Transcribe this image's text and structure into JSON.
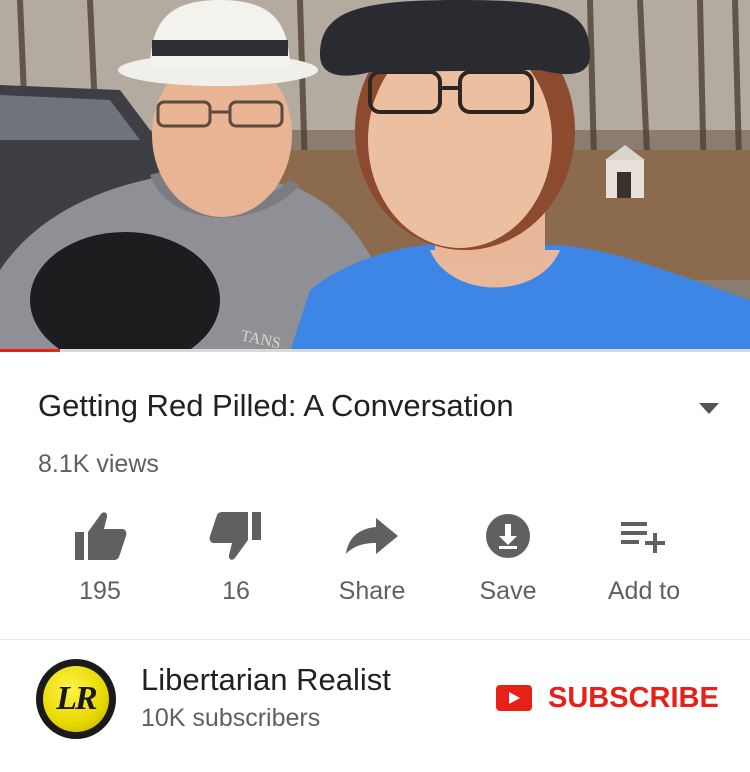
{
  "video": {
    "title": "Getting Red Pilled: A Conversation",
    "views": "8.1K views",
    "progress": 0.08
  },
  "actions": [
    {
      "icon": "thumbs-up-icon",
      "label": "195"
    },
    {
      "icon": "thumbs-down-icon",
      "label": "16"
    },
    {
      "icon": "share-arrow-icon",
      "label": "Share"
    },
    {
      "icon": "download-icon",
      "label": "Save"
    },
    {
      "icon": "add-to-playlist-icon",
      "label": "Add to"
    }
  ],
  "channel": {
    "name": "Libertarian Realist",
    "subscribers": "10K subscribers",
    "avatar_text": "LR",
    "subscribe_label": "SUBSCRIBE"
  },
  "thumbnail_text": "TANS",
  "colors": {
    "accent": "#e62117",
    "text_primary": "#212121",
    "text_secondary": "#606060",
    "avatar_yellow": "#e8d800"
  }
}
